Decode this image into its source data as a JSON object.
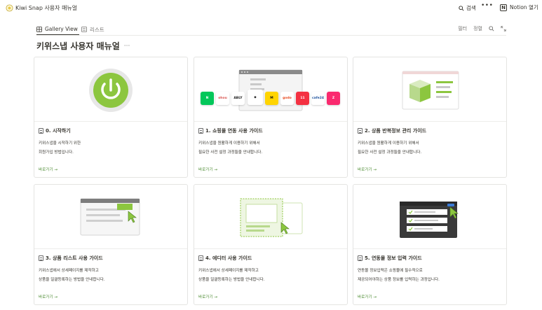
{
  "app": {
    "title": "Kiwi Snap 사용자 매뉴얼",
    "logo_icon": "kiwi-logo-icon"
  },
  "topbar": {
    "search_label": "검색",
    "more_label": "•••",
    "open_notion_label": "Notion 열기",
    "notion_logo_letter": "N"
  },
  "views": {
    "tabs": [
      {
        "label": "Gallery View",
        "icon": "gallery-grid-icon"
      },
      {
        "label": "리스트",
        "icon": "list-icon"
      }
    ],
    "filter_label": "필터",
    "sort_label": "정렬"
  },
  "page": {
    "title": "키위스냅 사용자 매뉴얼",
    "title_more": "···"
  },
  "colors": {
    "accent_green": "#8cc63f",
    "link_green": "#4a8a2f",
    "border": "#e4e4e2"
  },
  "cards": [
    {
      "title": "0. 시작하기",
      "desc1": "키위스냅을 시작하기 위한",
      "desc2": "회원가입 방법입니다.",
      "link": "바로가기 →"
    },
    {
      "title": "1. 쇼핑몰 연동 사용 가이드",
      "desc1": "키위스냅을 원활하게 이용하기 위해서",
      "desc2": "필요한 사전 설정 과정들을 안내합니다.",
      "link": "바로가기 →",
      "brands": [
        {
          "label": "N",
          "bg": "#03c75a",
          "fg": "#ffffff"
        },
        {
          "label": "ohou",
          "bg": "#ffffff",
          "fg": "#d9534f"
        },
        {
          "label": "ABLY",
          "bg": "#ffffff",
          "fg": "#222222"
        },
        {
          "label": "◆",
          "bg": "#ffffff",
          "fg": "#222222"
        },
        {
          "label": "M",
          "bg": "#ffd400",
          "fg": "#111111"
        },
        {
          "label": "godo",
          "bg": "#ffffff",
          "fg": "#e8481c"
        },
        {
          "label": "11",
          "bg": "#f43142",
          "fg": "#ffffff"
        },
        {
          "label": "cafe24",
          "bg": "#ffffff",
          "fg": "#1b4f9c"
        },
        {
          "label": "Z",
          "bg": "#fa2a6f",
          "fg": "#ffffff"
        }
      ]
    },
    {
      "title": "2. 상품 반복정보 관리 가이드",
      "desc1": "키위스냅을 원활하게 이용하기 위해서",
      "desc2": "필요한 사전 설정 과정들을 안내합니다.",
      "link": "바로가기 →"
    },
    {
      "title": "3. 상품 리스트 사용 가이드",
      "desc1": "키위스냅에서 상세페이지를 제작하고",
      "desc2": "상품을 일괄등록하는 방법을 안내합니다.",
      "link": "바로가기 →"
    },
    {
      "title": "4. 에디터 사용 가이드",
      "desc1": "키위스냅에서 상세페이지를 제작하고",
      "desc2": "상품을 일괄등록하는 방법을 안내합니다.",
      "link": "바로가기 →"
    },
    {
      "title": "5. 연동몰 정보 입력 가이드",
      "desc1": "연동몰 정보입력은 쇼핑몰에 필수적으로",
      "desc2": "제공되어야하는 상품 정보를 입력하는 과정입니다.",
      "link": "바로가기 →"
    }
  ]
}
